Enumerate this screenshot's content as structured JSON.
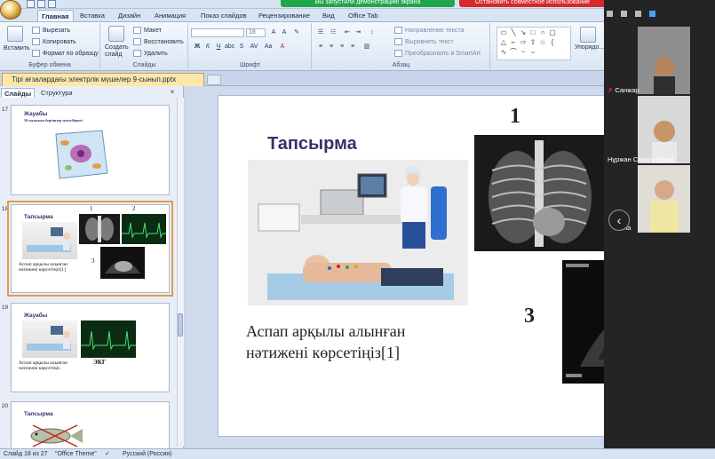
{
  "ribbon": {
    "tabs": [
      "Главная",
      "Вставка",
      "Дизайн",
      "Анимация",
      "Показ слайдов",
      "Рецензирование",
      "Вид",
      "Office Tab"
    ],
    "clipboard": {
      "paste": "Вставить",
      "cut": "Вырезать",
      "copy": "Копировать",
      "format_painter": "Формат по образцу",
      "label": "Буфер обмена"
    },
    "slides": {
      "new_slide": "Создать слайд",
      "layout": "Макет",
      "reset": "Восстановить",
      "delete": "Удалить",
      "label": "Слайды"
    },
    "font": {
      "size": "18",
      "label": "Шрифт"
    },
    "paragraph": {
      "text_direction": "Направление текста",
      "align_text": "Выровнять текст",
      "smartart": "Преобразовать в SmartArt",
      "label": "Абзац"
    },
    "drawing": {
      "arrange": "Упорядо..."
    }
  },
  "banners": {
    "share": "Вы запустили демонстрацию экрана",
    "stop": "Остановить совместное использование"
  },
  "document": {
    "tab_title": "Тірі ағзалардағы электрлік мүшелер 9-сынып.pptx"
  },
  "panel": {
    "tabs": [
      "Слайды",
      "Структура"
    ],
    "close": "×",
    "thumbnails": [
      {
        "number": "17",
        "title": "Жауабы",
        "subtitle": "10-сызылым бергіштер мектебіндегі"
      },
      {
        "number": "18",
        "title": "Тапсырма",
        "caption": "Аспап арқылы алынған нәтижені көрсетіңіз[1]",
        "n1": "1",
        "n2": "2",
        "n3": "3"
      },
      {
        "number": "19",
        "title": "Жауабы",
        "caption": "Аспап арқылы алынған нәтижені көрсетіңіз",
        "ecg": "ЭКГ"
      },
      {
        "number": "20",
        "title": "Тапсырма"
      }
    ]
  },
  "slide": {
    "title": "Тапсырма",
    "instruction_line1": "Аспап  арқылы алынған",
    "instruction_line2": "нәтижені көрсетіңіз[1]",
    "label1": "1",
    "label3": "3"
  },
  "participants": [
    {
      "name": "Санжар"
    },
    {
      "name": "Нұржан Сарқытбеков"
    },
    {
      "name": ""
    }
  ],
  "participant_suffix": "на",
  "nav": "‹",
  "status": {
    "slide": "Слайд 18 из 27",
    "theme": "\"Office Theme\"",
    "language": "Русский (Россия)"
  },
  "colors": {
    "accent_title": "#3a2f6a",
    "share_green": "#1fa64a",
    "stop_red": "#d7282b",
    "selected_outline": "#e59a4a"
  }
}
